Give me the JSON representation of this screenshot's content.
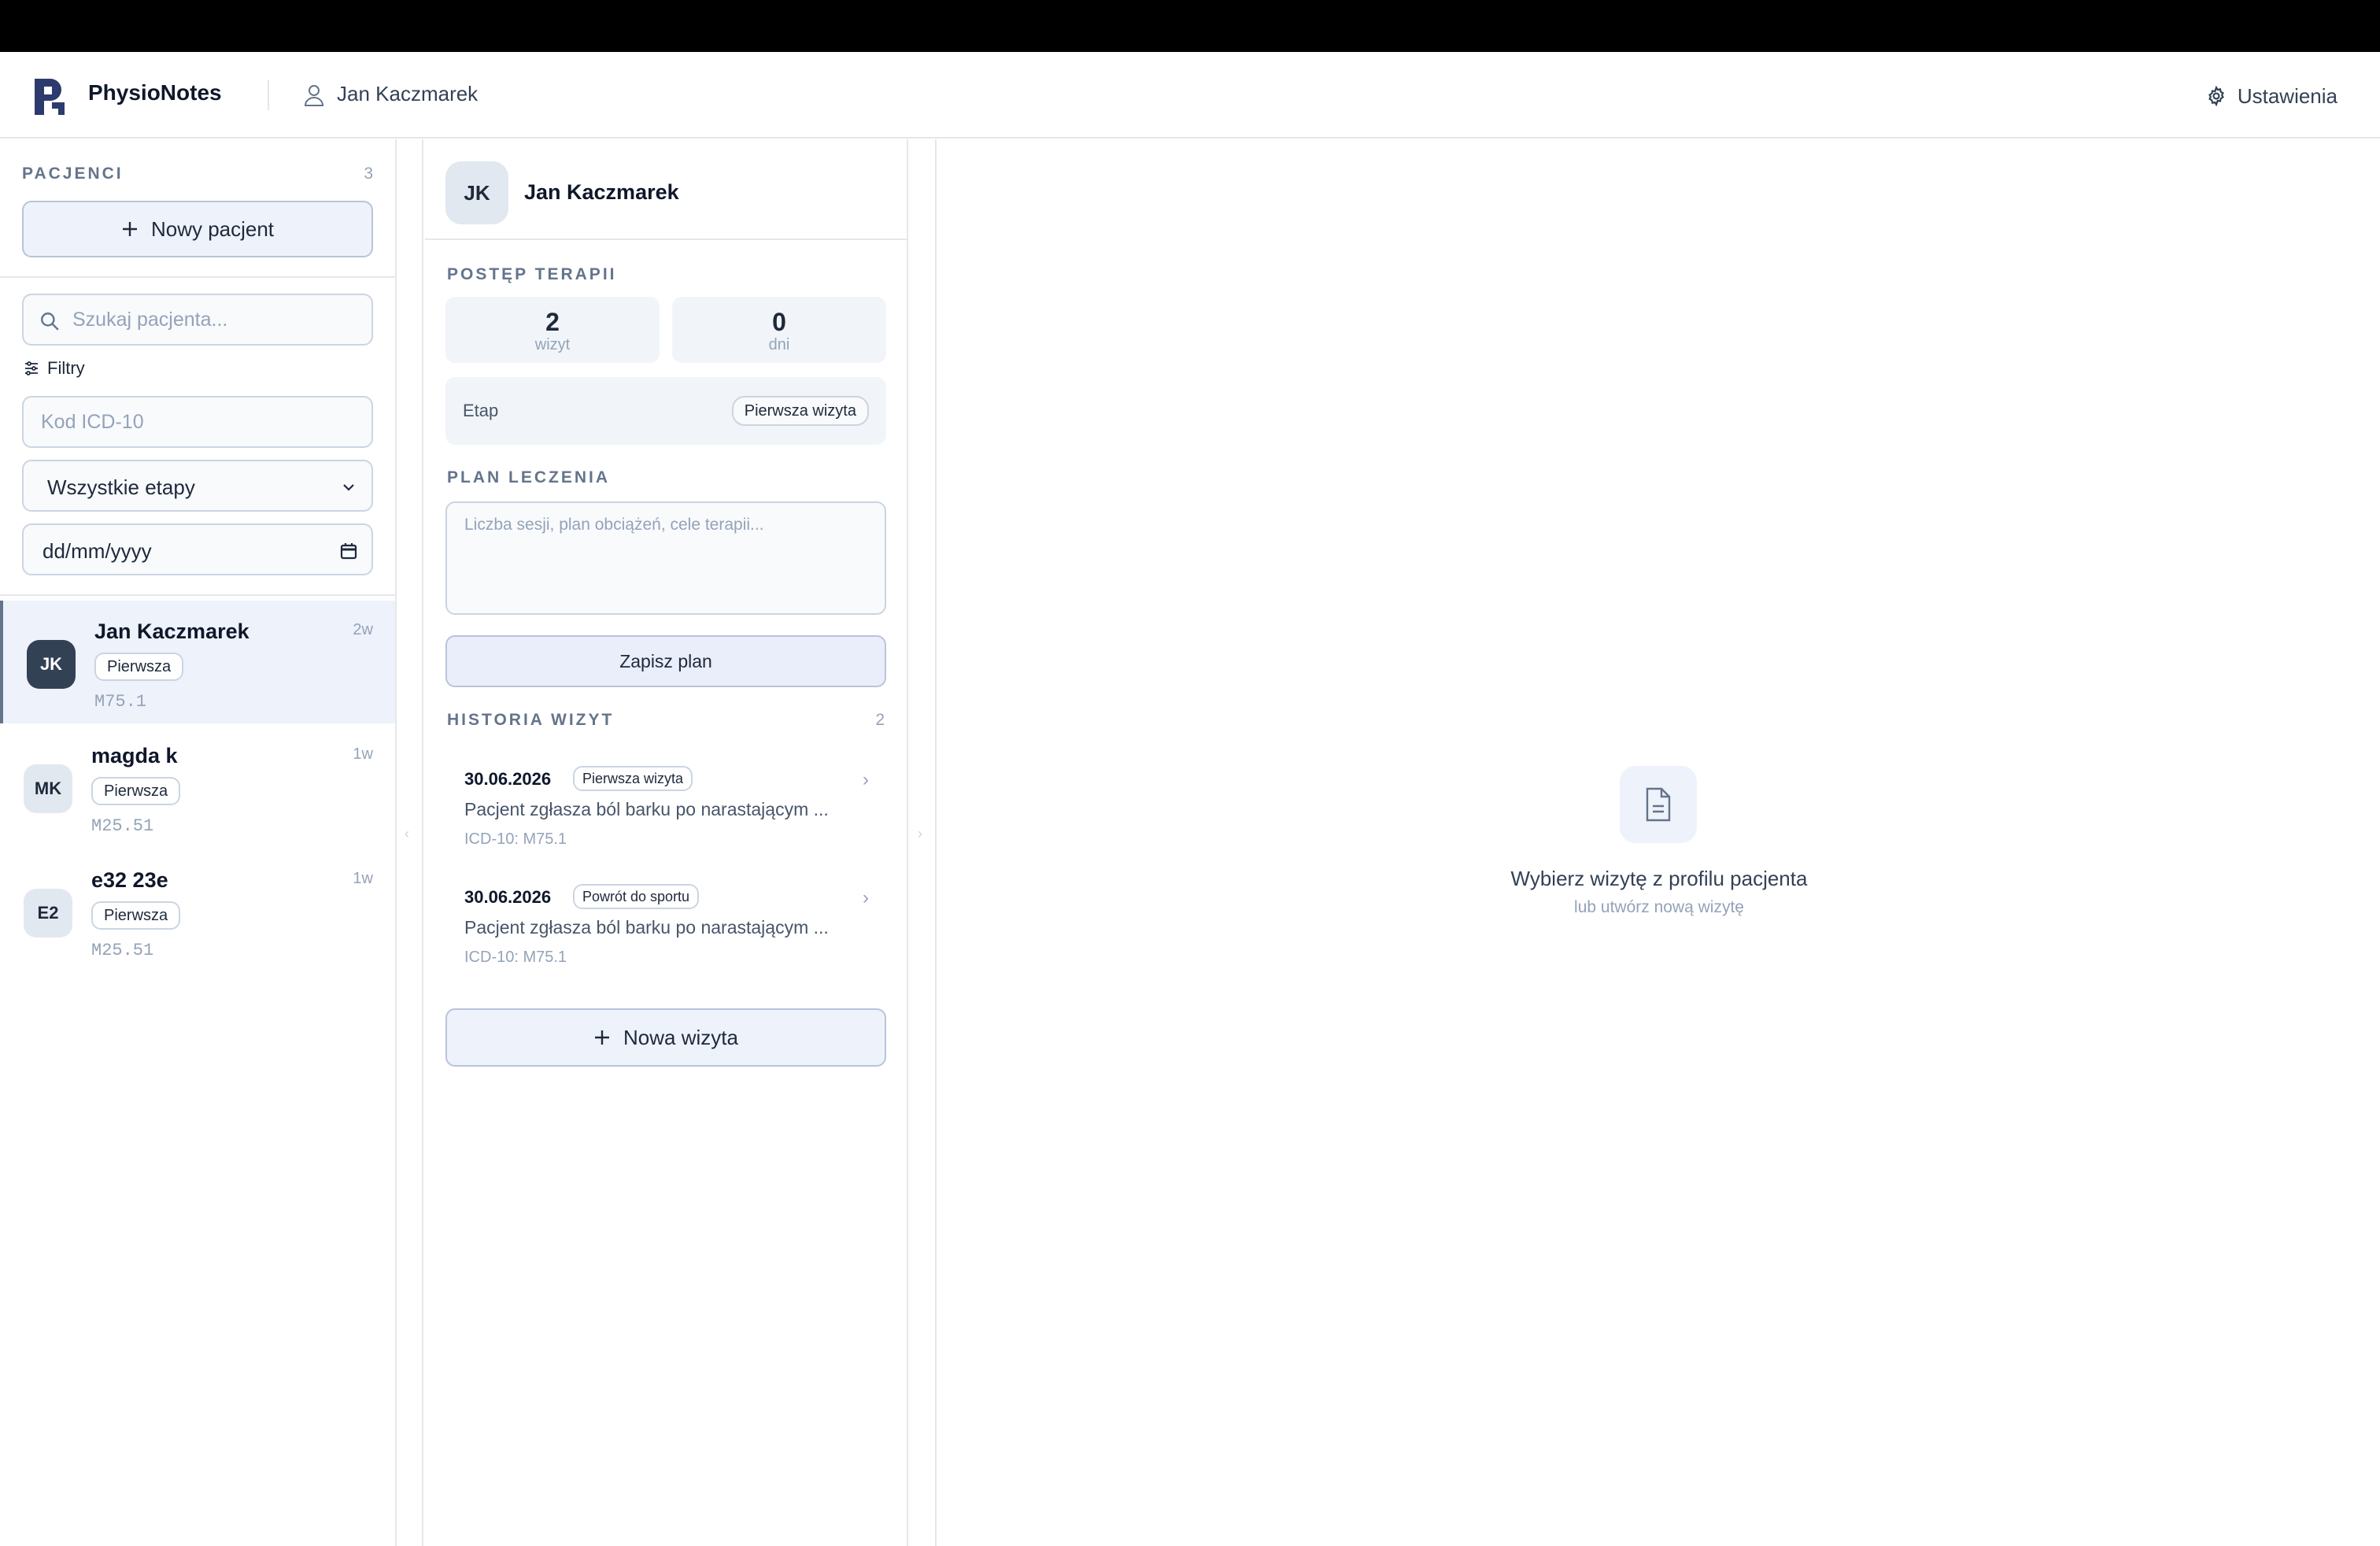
{
  "app": {
    "name": "PhysioNotes",
    "current_user": "Jan Kaczmarek",
    "settings_label": "Ustawienia"
  },
  "sidebar": {
    "section_label": "PACJENCI",
    "patient_count": "3",
    "new_patient_label": "Nowy pacjent",
    "search_placeholder": "Szukaj pacjenta...",
    "filters_label": "Filtry",
    "icd_placeholder": "Kod ICD-10",
    "stage_select": "Wszystkie etapy",
    "date_value": "dd/mm/yyyy",
    "patients": [
      {
        "initials": "JK",
        "name": "Jan Kaczmarek",
        "stage": "Pierwsza",
        "code": "M75.1",
        "time": "2w",
        "active": true
      },
      {
        "initials": "MK",
        "name": "magda k",
        "stage": "Pierwsza",
        "code": "M25.51",
        "time": "1w",
        "active": false
      },
      {
        "initials": "E2",
        "name": "e32 23e",
        "stage": "Pierwsza",
        "code": "M25.51",
        "time": "1w",
        "active": false
      }
    ]
  },
  "profile": {
    "initials": "JK",
    "name": "Jan Kaczmarek",
    "progress_label": "POSTĘP TERAPII",
    "visits_count": "2",
    "visits_unit": "wizyt",
    "days_count": "0",
    "days_unit": "dni",
    "stage_label": "Etap",
    "stage_value": "Pierwsza wizyta",
    "plan_label": "PLAN LECZENIA",
    "plan_placeholder": "Liczba sesji, plan obciążeń, cele terapii...",
    "save_plan_label": "Zapisz plan",
    "history_label": "HISTORIA WIZYT",
    "history_count": "2",
    "visits": [
      {
        "date": "30.06.2026",
        "badge": "Pierwsza wizyta",
        "desc": "Pacjent zgłasza ból barku po narastającym ...",
        "code": "ICD-10: M75.1"
      },
      {
        "date": "30.06.2026",
        "badge": "Powrót do sportu",
        "desc": "Pacjent zgłasza ból barku po narastającym ...",
        "code": "ICD-10: M75.1"
      }
    ],
    "new_visit_label": "Nowa wizyta"
  },
  "main": {
    "empty_title": "Wybierz wizytę z profilu pacjenta",
    "empty_subtitle": "lub utwórz nową wizytę"
  },
  "colors": {
    "accent": "#2d3a6e",
    "active_row": "#eef2fa",
    "dark_avatar": "#334155"
  }
}
